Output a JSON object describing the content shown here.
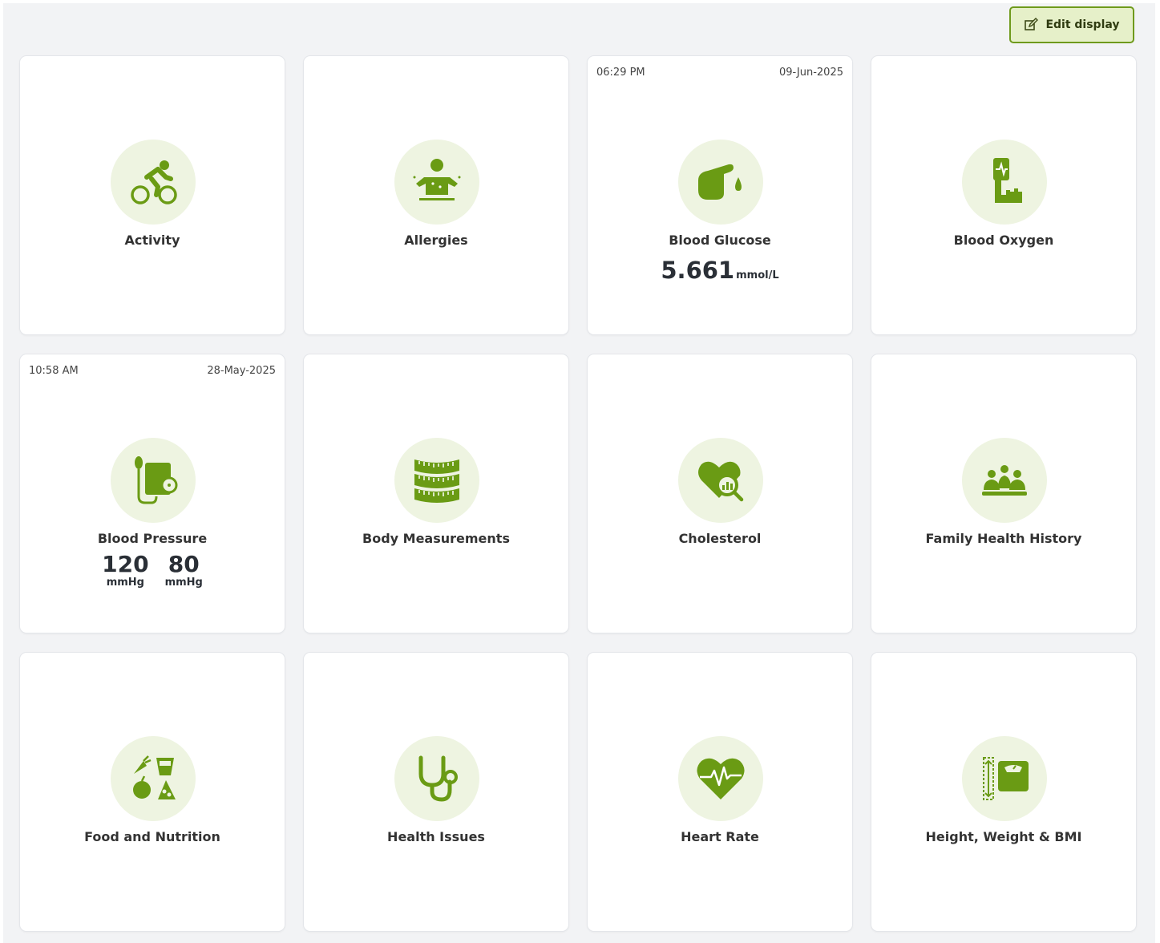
{
  "header": {
    "edit_label": "Edit display"
  },
  "colors": {
    "accent": "#6a9b14",
    "icon_bg": "#eef4e1",
    "page_bg": "#f2f3f5"
  },
  "cards": [
    {
      "label": "Activity",
      "icon": "cycling-icon"
    },
    {
      "label": "Allergies",
      "icon": "allergy-person-icon"
    },
    {
      "label": "Blood Glucose",
      "icon": "finger-drop-icon",
      "time": "06:29 PM",
      "date": "09-Jun-2025",
      "value": "5.661",
      "unit": "mmol/L"
    },
    {
      "label": "Blood Oxygen",
      "icon": "pulse-oximeter-icon"
    },
    {
      "label": "Blood Pressure",
      "icon": "blood-pressure-cuff-icon",
      "time": "10:58 AM",
      "date": "28-May-2025",
      "systolic": "120",
      "systolic_unit": "mmHg",
      "diastolic": "80",
      "diastolic_unit": "mmHg"
    },
    {
      "label": "Body Measurements",
      "icon": "measuring-tape-icon"
    },
    {
      "label": "Cholesterol",
      "icon": "heart-magnifier-icon"
    },
    {
      "label": "Family Health History",
      "icon": "family-icon"
    },
    {
      "label": "Food and Nutrition",
      "icon": "food-icon"
    },
    {
      "label": "Health Issues",
      "icon": "stethoscope-icon"
    },
    {
      "label": "Heart Rate",
      "icon": "heart-pulse-icon"
    },
    {
      "label": "Height, Weight & BMI",
      "icon": "height-scale-icon"
    }
  ]
}
